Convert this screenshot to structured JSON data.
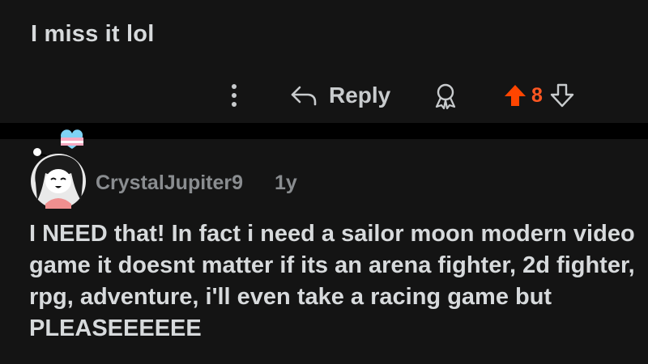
{
  "previous_comment": {
    "text": "I miss it lol",
    "actions": {
      "more_icon": "vertical-ellipsis-icon",
      "reply_icon": "reply-arrow-icon",
      "reply_label": "Reply",
      "award_icon": "award-icon",
      "upvote_icon": "upvote-arrow-icon",
      "score": "8",
      "downvote_icon": "downvote-arrow-icon"
    }
  },
  "comment": {
    "avatar_icon": "user-avatar",
    "flair_icon": "heart-flair-icon",
    "username": "CrystalJupiter9",
    "age": "1y",
    "body": "I NEED that! In fact i need a sailor moon modern video game it doesnt matter if its an arena fighter, 2d fighter, rpg, adventure, i'll even take a racing game but PLEASEEEEEE"
  },
  "colors": {
    "background": "#000000",
    "card": "#141414",
    "text": "#d7dadc",
    "muted": "#8a8d90",
    "upvote_accent": "#ff5722",
    "flair_blue": "#7fd3f5",
    "flair_pink": "#f6a8c0"
  }
}
